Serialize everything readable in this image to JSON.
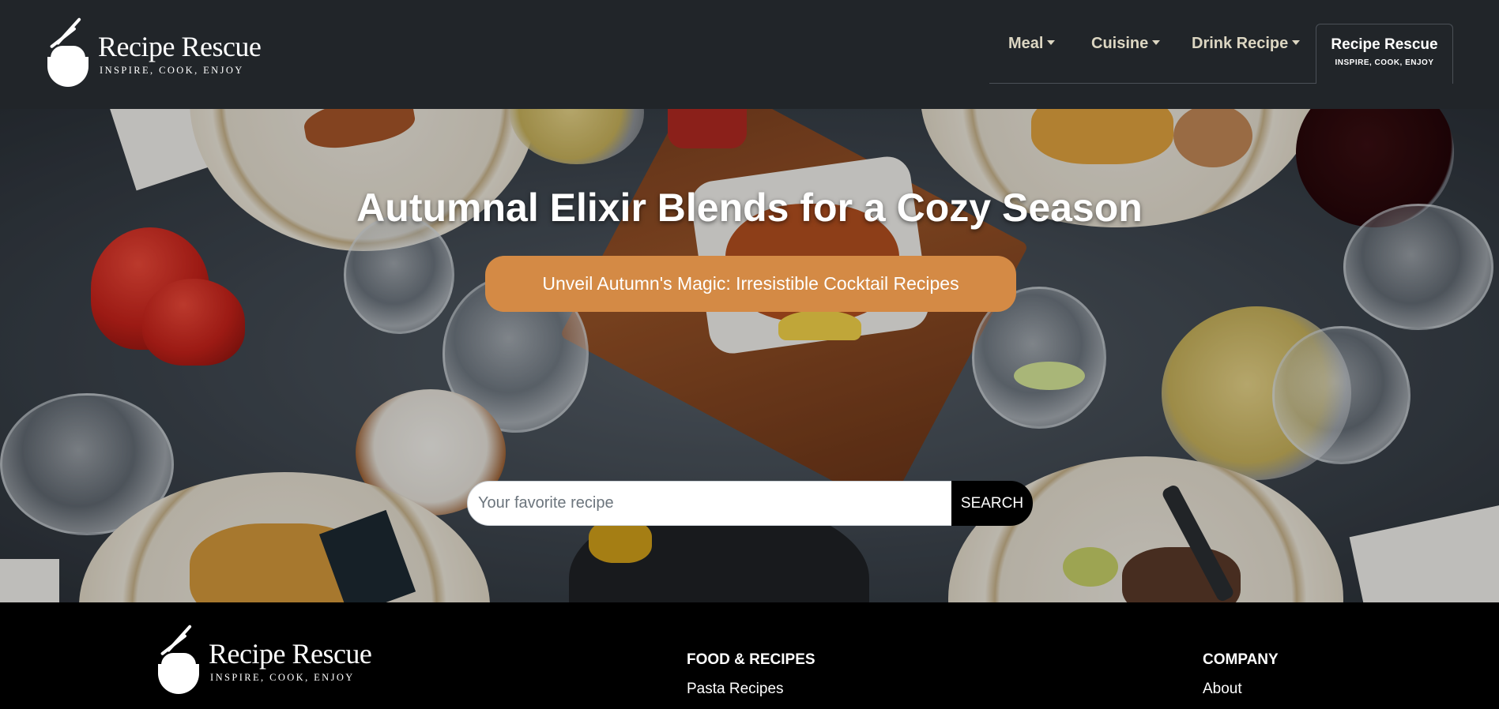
{
  "brand": {
    "name": "Recipe Rescue",
    "tagline": "INSPIRE, COOK, ENJOY"
  },
  "nav": {
    "items": [
      {
        "label": "Meal",
        "icon": "caret-down-icon"
      },
      {
        "label": "Cuisine",
        "icon": "caret-down-icon"
      },
      {
        "label": "Drink Recipe",
        "icon": "caret-down-icon"
      }
    ],
    "active": {
      "title": "Recipe Rescue",
      "tagline": "INSPIRE, COOK, ENJOY"
    }
  },
  "hero": {
    "title": "Autumnal Elixir Blends for a Cozy Season",
    "cta_label": "Unveil Autumn's Magic: Irresistible Cocktail Recipes",
    "search": {
      "placeholder": "Your favorite recipe",
      "value": "",
      "button_label": "SEARCH"
    }
  },
  "footer": {
    "brand": {
      "name": "Recipe Rescue",
      "tagline": "INSPIRE, COOK, ENJOY"
    },
    "columns": [
      {
        "heading": "FOOD & RECIPES",
        "links": [
          "Pasta Recipes"
        ]
      },
      {
        "heading": "COMPANY",
        "links": [
          "About"
        ]
      }
    ]
  },
  "colors": {
    "navbar_bg": "#212529",
    "nav_text": "#dcd6c2",
    "cta_bg": "#d48a45",
    "footer_bg": "#000000",
    "search_button_bg": "#000000"
  }
}
